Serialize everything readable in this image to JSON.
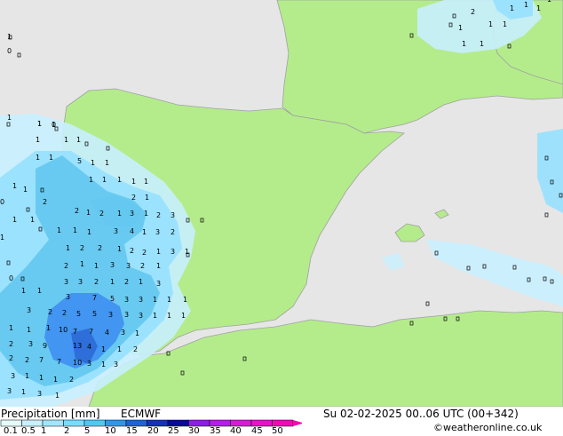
{
  "map": {
    "colors": {
      "sea": "#e6e6e6",
      "land": "#b4ec8c",
      "border": "#a0a0a0",
      "precip_light": "#c8f0ff",
      "precip_mid": "#64d2f0",
      "precip_heavy": "#3c8cf0"
    },
    "value_labels": [
      "1",
      "0",
      "1",
      "1",
      "5",
      "1",
      "1",
      "1",
      "1",
      "1",
      "1",
      "1",
      "1",
      "1",
      "2",
      "1",
      "2",
      "1",
      "2",
      "1",
      "3",
      "1",
      "2",
      "3",
      "1",
      "1",
      "1",
      "3",
      "4",
      "1",
      "3",
      "2",
      "1",
      "2",
      "2",
      "1",
      "2",
      "2",
      "1",
      "3",
      "1",
      "2",
      "1",
      "1",
      "3",
      "3",
      "2",
      "1",
      "3",
      "3",
      "2",
      "1",
      "2",
      "1",
      "3",
      "3",
      "7",
      "5",
      "3",
      "3",
      "1",
      "1",
      "1",
      "3",
      "2",
      "2",
      "5",
      "5",
      "3",
      "3",
      "3",
      "1",
      "1",
      "1",
      "1",
      "1",
      "1",
      "10",
      "7",
      "7",
      "4",
      "3",
      "1",
      "2",
      "3",
      "9",
      "13",
      "4",
      "1",
      "1",
      "2",
      "2",
      "2",
      "7",
      "7",
      "10",
      "3",
      "1",
      "3",
      "3",
      "1",
      "1",
      "1",
      "2",
      "3",
      "1",
      "3",
      "1",
      "1",
      "1",
      "0",
      "1",
      "1",
      "0",
      "1",
      "2",
      "1",
      "1",
      "1",
      "1",
      "1",
      "0",
      "1",
      "2",
      "1",
      "1",
      "1",
      "1",
      "1",
      "1",
      "1",
      "1",
      "1",
      "1"
    ]
  },
  "footer": {
    "title": "Precipitation [mm]",
    "model": "ECMWF",
    "datetime": "Su 02-02-2025 00..06 UTC (00+342)",
    "copyright": "©weatheronline.co.uk",
    "scale_labels": [
      "0.1",
      "0.5",
      "1",
      "2",
      "5",
      "10",
      "15",
      "20",
      "25",
      "30",
      "35",
      "40",
      "45",
      "50"
    ],
    "scale_colors": [
      "#e6fafa",
      "#c8f0ff",
      "#a0e6ff",
      "#78dcff",
      "#50c8f0",
      "#3296e6",
      "#1e64d2",
      "#1432b4",
      "#0a0a96",
      "#8c1ee6",
      "#b41ee6",
      "#d21ed2",
      "#e614c8",
      "#f00ab4"
    ]
  }
}
